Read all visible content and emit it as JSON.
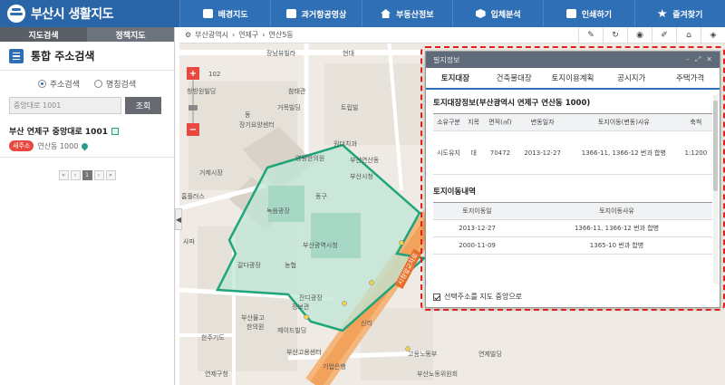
{
  "app": {
    "title": "부산시 생활지도"
  },
  "nav": [
    {
      "label": "배경지도",
      "icon": "map-icon"
    },
    {
      "label": "과거항공영상",
      "icon": "image-icon"
    },
    {
      "label": "부동산정보",
      "icon": "home-icon"
    },
    {
      "label": "입체분석",
      "icon": "cube-icon"
    },
    {
      "label": "인쇄하기",
      "icon": "printer-icon"
    },
    {
      "label": "즐겨찾기",
      "icon": "star-icon"
    }
  ],
  "left_panel": {
    "tabs": [
      "지도검색",
      "정책지도"
    ],
    "title": "통합 주소검색",
    "radio_options": [
      "주소검색",
      "명칭검색"
    ],
    "search_value": "중앙대로 1001",
    "search_button": "조회",
    "result": {
      "title": "부산 연제구 중앙대로 1001",
      "badge": "새주소",
      "sub": "연산동 1000"
    },
    "pager": [
      "«",
      "‹",
      "1",
      "›",
      "»"
    ]
  },
  "map": {
    "breadcrumb": [
      "부산광역시",
      "연제구",
      "연산5동"
    ],
    "zoom_in": "+",
    "zoom_out": "−",
    "labels": [
      "102",
      "장남뷰빌라",
      "현대",
      "참태관",
      "청방원빌딩",
      "거목빌딩",
      "동",
      "장기요양센터",
      "원더치과",
      "영광한의원",
      "트립빌",
      "부산연산동",
      "거제시장",
      "홈플러스",
      "녹음광장",
      "동구",
      "부산광역시청",
      "사파",
      "갈다광장",
      "농협",
      "부산시청",
      "정보관",
      "잔디광장",
      "신리",
      "부산물고",
      "한의원",
      "제이드빌딩",
      "한주기도",
      "부산고용센터",
      "연제구청",
      "고용노동부",
      "기업은행",
      "부산노동위원회",
      "연제빌딩"
    ],
    "road_label": "시청앞교차로"
  },
  "toolbar": [
    "ruler-icon",
    "refresh-icon",
    "location-icon",
    "edit-icon",
    "home-icon",
    "layers-icon"
  ],
  "popup": {
    "header": "필지정보",
    "tabs": [
      "토지대장",
      "건축물대장",
      "토지이용계획",
      "공시지가",
      "주택가격"
    ],
    "section1_title": "토지대장정보(부산광역시 연제구 연산동 1000)",
    "land_table": {
      "headers": [
        "소유구분",
        "지목",
        "면적(㎡)",
        "변동일자",
        "토지이동(변동)사유",
        "축척"
      ],
      "rows": [
        [
          "시도유지",
          "대",
          "70472",
          "2013-12-27",
          "1366-11, 1366-12 번과 합병",
          "1:1200"
        ]
      ]
    },
    "section2_title": "토지이동내역",
    "move_table": {
      "headers": [
        "토지이동일",
        "토지이동사유"
      ],
      "rows": [
        [
          "2013-12-27",
          "1366-11, 1366-12 번과 합병"
        ],
        [
          "2000-11-09",
          "1365-10 번과 합병"
        ]
      ]
    },
    "footer_check": "선택주소를 지도 중앙으로"
  }
}
